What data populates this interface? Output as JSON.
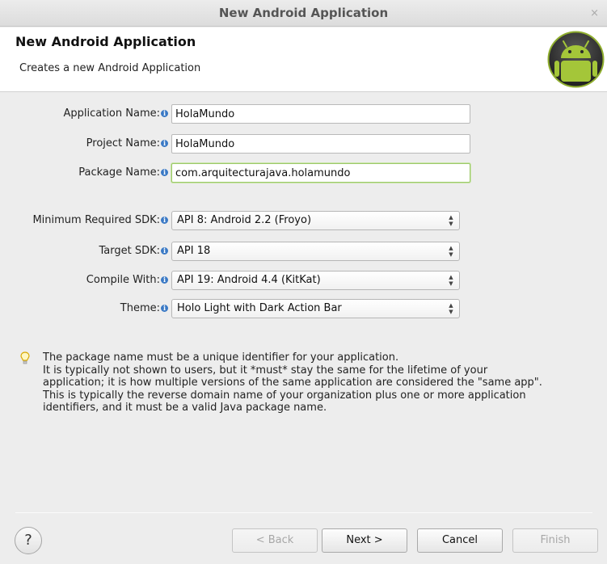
{
  "window": {
    "title": "New Android Application",
    "close_label": "×"
  },
  "banner": {
    "title": "New Android Application",
    "description": "Creates a new Android Application",
    "logo_icon": "android-logo-icon"
  },
  "form": {
    "application_name": {
      "label": "Application Name:",
      "value": "HolaMundo"
    },
    "project_name": {
      "label": "Project Name:",
      "value": "HolaMundo"
    },
    "package_name": {
      "label": "Package Name:",
      "value": "com.arquitecturajava.holamundo"
    },
    "info_glyph": "i"
  },
  "sdk": {
    "minimum": {
      "label": "Minimum Required SDK:",
      "value": "API 8: Android 2.2 (Froyo)"
    },
    "target": {
      "label": "Target SDK:",
      "value": "API 18"
    },
    "compile": {
      "label": "Compile With:",
      "value": "API 19: Android 4.4 (KitKat)"
    },
    "theme": {
      "label": "Theme:",
      "value": "Holo Light with Dark Action Bar"
    }
  },
  "hint": {
    "icon": "lightbulb-icon",
    "lines": [
      "The package name must be a unique identifier for your application.",
      "It is typically not shown to users, but it *must* stay the same for the lifetime of your",
      "application; it is how multiple versions of the same application are considered the \"same app\".",
      "This is typically the reverse domain name of your organization plus one or more application",
      "identifiers, and it must be a valid Java package name."
    ]
  },
  "buttons": {
    "help": "?",
    "back": "< Back",
    "next": "Next >",
    "cancel": "Cancel",
    "finish": "Finish"
  },
  "colors": {
    "android_green": "#a4c639",
    "info_blue": "#3a79c5",
    "focus_green": "#9cc96a"
  }
}
